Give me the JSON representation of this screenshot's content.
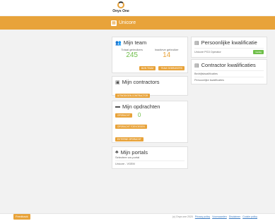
{
  "brand": {
    "logo_text": "Onyx One"
  },
  "org": {
    "icon": "building-icon",
    "name": "Unicore"
  },
  "cards": {
    "team": {
      "title": "Mijn team",
      "left_label": "Totaal gebruikers",
      "left_value": "245",
      "right_label": "Inactieve gebruiker",
      "right_value": "14",
      "buttons": [
        "MIJN TEAM",
        "TEAM GEBRUIKERS"
      ]
    },
    "persoonlijke": {
      "title": "Persoonlijke kwalificatie",
      "item": "Unicore PG3 Operator",
      "badge": "Geldig"
    },
    "contractor_kwal": {
      "title": "Contractor kwalificaties",
      "items": [
        "Bedrijfskwalificaties",
        "Persoonlijke kwalificaties"
      ]
    },
    "contractors": {
      "title": "Mijn contractors",
      "button": "UITNODIGEN CONTRACTOR"
    },
    "opdrachten": {
      "title": "Mijn opdrachten",
      "count": "0",
      "buttons": [
        "OPDRACHT",
        "OPDRACHT TOEVOEGEN",
        "EXTERNE OPDRACHT",
        "UITVOERDER OPDRACHTEN TOEVOEGEN"
      ]
    },
    "portals": {
      "title": "Mijn portals",
      "subtitle": "Selecteer uw portal",
      "item": "Unicore - VGEM"
    }
  },
  "footer": {
    "feedback": "Feedback",
    "copyright": "(c) Onyx.one 2020",
    "links": [
      "Privacy policy",
      "Voorwaarden",
      "Disclaimer",
      "Cookie policy"
    ]
  }
}
